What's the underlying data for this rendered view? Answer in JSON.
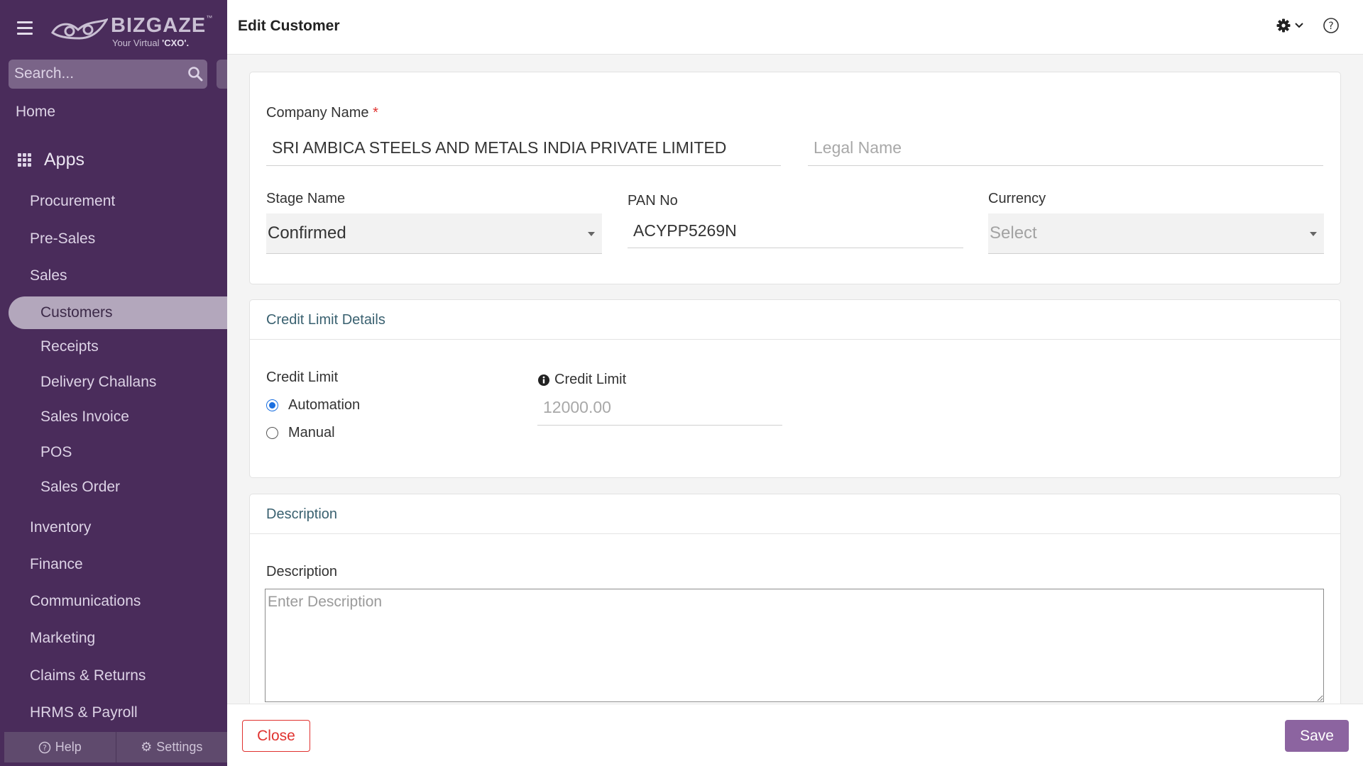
{
  "app": {
    "brand": "BIZGAZE",
    "tagline_prefix": "Your Virtual ",
    "tagline_emphasis": "'CXO'.",
    "trademark": "™"
  },
  "sidebar": {
    "search_placeholder": "Search...",
    "home": "Home",
    "apps_label": "Apps",
    "modules": [
      "Procurement",
      "Pre-Sales",
      "Sales",
      "Inventory",
      "Finance",
      "Communications",
      "Marketing",
      "Claims & Returns",
      "HRMS & Payroll"
    ],
    "sales_submenu": {
      "active": "Customers",
      "items": [
        "Receipts",
        "Delivery Challans",
        "Sales Invoice",
        "POS",
        "Sales Order"
      ]
    },
    "footer": {
      "help": "Help",
      "settings": "Settings"
    }
  },
  "header": {
    "title": "Edit Customer",
    "icons": [
      "gear-icon",
      "chevron-down-icon",
      "help-circle-icon"
    ]
  },
  "form": {
    "company_name": {
      "label": "Company Name",
      "required_mark": "*",
      "value": "SRI AMBICA STEELS AND METALS INDIA PRIVATE LIMITED"
    },
    "legal_name": {
      "placeholder": "Legal Name",
      "value": ""
    },
    "stage_name": {
      "label": "Stage Name",
      "value": "Confirmed"
    },
    "pan_no": {
      "label": "PAN No",
      "value": "ACYPP5269N"
    },
    "currency": {
      "label": "Currency",
      "placeholder": "Select"
    }
  },
  "credit_section": {
    "title": "Credit Limit Details",
    "credit_limit_label": "Credit Limit",
    "options": [
      {
        "label": "Automation",
        "checked": true
      },
      {
        "label": "Manual",
        "checked": false
      }
    ],
    "amount_label": "Credit Limit",
    "amount_value": "12000.00"
  },
  "description_section": {
    "title": "Description",
    "field_label": "Description",
    "placeholder": "Enter Description"
  },
  "actions": {
    "close": "Close",
    "save": "Save"
  },
  "colors": {
    "sidebar_bg": "#4a2c5b",
    "active_item_bg": "#b3a7bc",
    "section_title": "#3a6170",
    "required": "#e0322f",
    "save_bg": "#8c64a0",
    "radio_checked": "#1a6fe0"
  }
}
